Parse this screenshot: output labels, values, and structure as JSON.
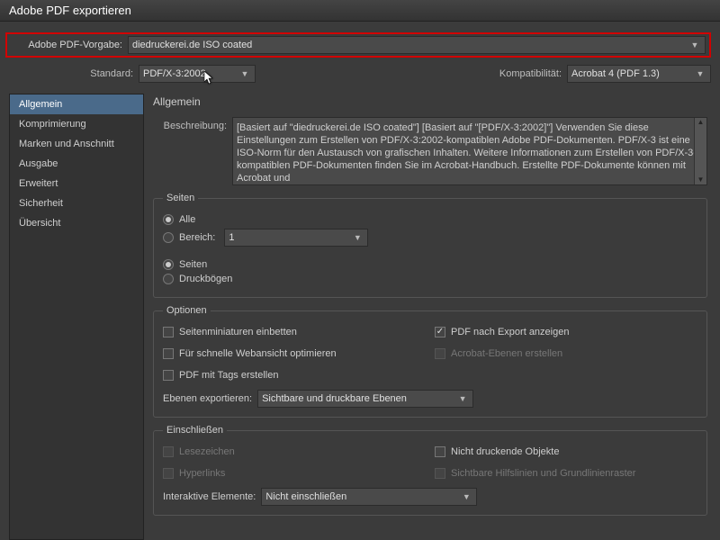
{
  "window": {
    "title": "Adobe PDF exportieren"
  },
  "header": {
    "preset_label": "Adobe PDF-Vorgabe:",
    "preset_value": "diedruckerei.de ISO coated",
    "standard_label": "Standard:",
    "standard_value": "PDF/X-3:2002",
    "compat_label": "Kompatibilität:",
    "compat_value": "Acrobat 4 (PDF 1.3)"
  },
  "sidebar": {
    "items": [
      {
        "label": "Allgemein"
      },
      {
        "label": "Komprimierung"
      },
      {
        "label": "Marken und Anschnitt"
      },
      {
        "label": "Ausgabe"
      },
      {
        "label": "Erweitert"
      },
      {
        "label": "Sicherheit"
      },
      {
        "label": "Übersicht"
      }
    ]
  },
  "panel": {
    "title": "Allgemein",
    "desc_label": "Beschreibung:",
    "description": "[Basiert auf \"diedruckerei.de ISO coated\"] [Basiert auf \"[PDF/X-3:2002]\"] Verwenden Sie diese Einstellungen zum Erstellen von PDF/X-3:2002-kompatiblen Adobe PDF-Dokumenten. PDF/X-3 ist eine ISO-Norm für den Austausch von grafischen Inhalten. Weitere Informationen zum Erstellen von PDF/X-3-kompatiblen PDF-Dokumenten finden Sie im Acrobat-Handbuch. Erstellte PDF-Dokumente können mit Acrobat und",
    "pages": {
      "legend": "Seiten",
      "all": "Alle",
      "range": "Bereich:",
      "range_value": "1",
      "pages_radio": "Seiten",
      "spreads_radio": "Druckbögen"
    },
    "options": {
      "legend": "Optionen",
      "thumbs": "Seitenminiaturen einbetten",
      "view_after": "PDF nach Export anzeigen",
      "fast_web": "Für schnelle Webansicht optimieren",
      "acro_layers": "Acrobat-Ebenen erstellen",
      "tagged": "PDF mit Tags erstellen",
      "export_layers_label": "Ebenen exportieren:",
      "export_layers_value": "Sichtbare und druckbare Ebenen"
    },
    "include": {
      "legend": "Einschließen",
      "bookmarks": "Lesezeichen",
      "nonprint": "Nicht druckende Objekte",
      "hyperlinks": "Hyperlinks",
      "guides": "Sichtbare Hilfslinien und Grundlinienraster",
      "interactive_label": "Interaktive Elemente:",
      "interactive_value": "Nicht einschließen"
    }
  }
}
